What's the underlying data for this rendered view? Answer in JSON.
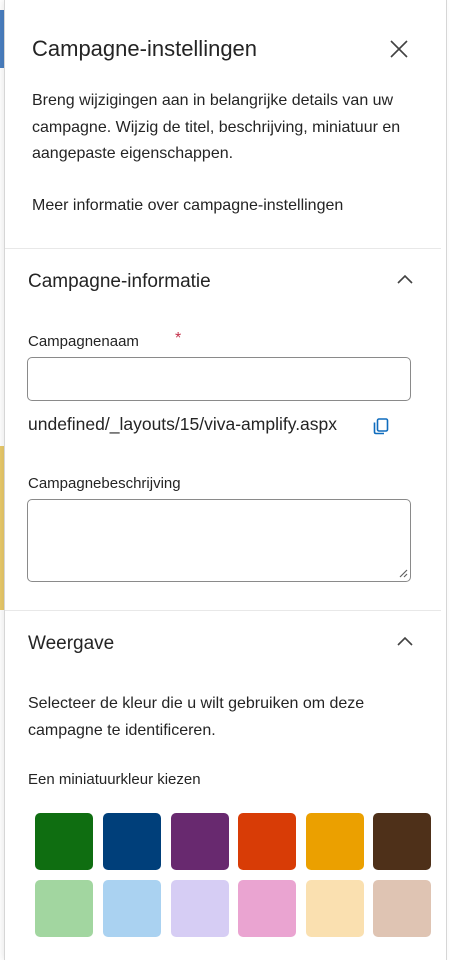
{
  "panel": {
    "title": "Campagne-instellingen",
    "description": "Breng wijzigingen aan in belangrijke details van uw campagne. Wijzig de titel, beschrijving, miniatuur en aangepaste eigenschappen.",
    "learn_more": "Meer informatie over campagne-instellingen",
    "close_icon": "close-icon"
  },
  "campaign_info": {
    "heading": "Campagne-informatie",
    "name_label": "Campagnenaam",
    "required_marker": "*",
    "name_value": "",
    "url": "undefined/_layouts/15/viva-amplify.aspx",
    "copy_icon": "copy-icon",
    "description_label": "Campagnebeschrijving",
    "description_value": ""
  },
  "appearance": {
    "heading": "Weergave",
    "color_description": "Selecteer de kleur die u wilt gebruiken om deze campagne te identificeren.",
    "color_label": "Een miniatuurkleur kiezen",
    "colors_row1": [
      "#0f6e11",
      "#003f7a",
      "#68296f",
      "#d83c06",
      "#eba000",
      "#4e3019"
    ],
    "colors_row2": [
      "#a2d6a0",
      "#aad2f1",
      "#d6cdf4",
      "#eaa4d1",
      "#fae0b0",
      "#dfc4b3"
    ]
  },
  "colors": {
    "accent": "#0f6cbd",
    "required": "#c4314b",
    "text": "#242424"
  }
}
